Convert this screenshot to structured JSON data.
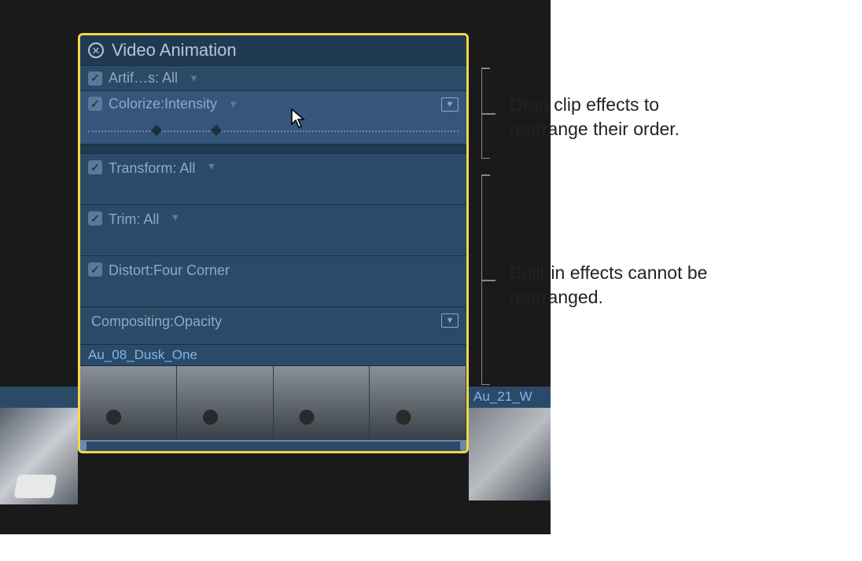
{
  "panel": {
    "title": "Video Animation"
  },
  "effects": {
    "clip": [
      {
        "label": "Artif…s: All",
        "checked": true,
        "chevron": true
      },
      {
        "label": "Colorize:Intensity",
        "checked": true,
        "chevron": true,
        "dragging": true,
        "expandable": true
      }
    ],
    "builtin": [
      {
        "label": "Transform: All",
        "checked": true,
        "chevron": true
      },
      {
        "label": "Trim: All",
        "checked": true,
        "chevron": true
      },
      {
        "label": "Distort:Four Corner",
        "checked": true,
        "chevron": false
      },
      {
        "label": "Compositing:Opacity",
        "checked": false,
        "chevron": false,
        "expandable": true
      }
    ]
  },
  "clips": {
    "current": "Au_08_Dusk_One",
    "next": "Au_21_W"
  },
  "callouts": {
    "drag": "Drag clip effects to rearrange their order.",
    "builtin": "Built-in effects cannot be rearranged."
  }
}
